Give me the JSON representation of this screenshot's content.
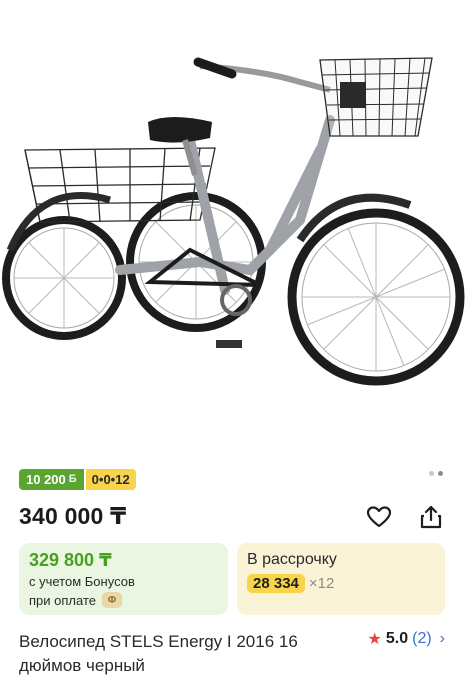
{
  "product_image": {
    "alt": "Велосипед STELS Energy I 2016 16 дюймов черный"
  },
  "gallery": {
    "dots_total": 2,
    "active_index": 1
  },
  "badges": {
    "bonus": "10 200",
    "bonus_icon": "Б",
    "installment": "0•0•12"
  },
  "price": {
    "main": "340 000 ₸"
  },
  "actions": {
    "favorite_icon": "heart-icon",
    "share_icon": "share-icon"
  },
  "bonus_card": {
    "amount": "329 800 ₸",
    "line1": "с учетом Бонусов",
    "line2": "при оплате",
    "coin_icon": "Ф"
  },
  "installment_card": {
    "title": "В рассрочку",
    "monthly": "28 334",
    "months": "×12"
  },
  "product": {
    "title": "Велосипед STELS Energy I 2016 16 дюймов черный"
  },
  "rating": {
    "score": "5.0",
    "count": "(2)",
    "star_color": "#e8453c"
  },
  "colors": {
    "green": "#5aa52f",
    "yellow": "#f7d44b",
    "link": "#3d6fd8"
  }
}
